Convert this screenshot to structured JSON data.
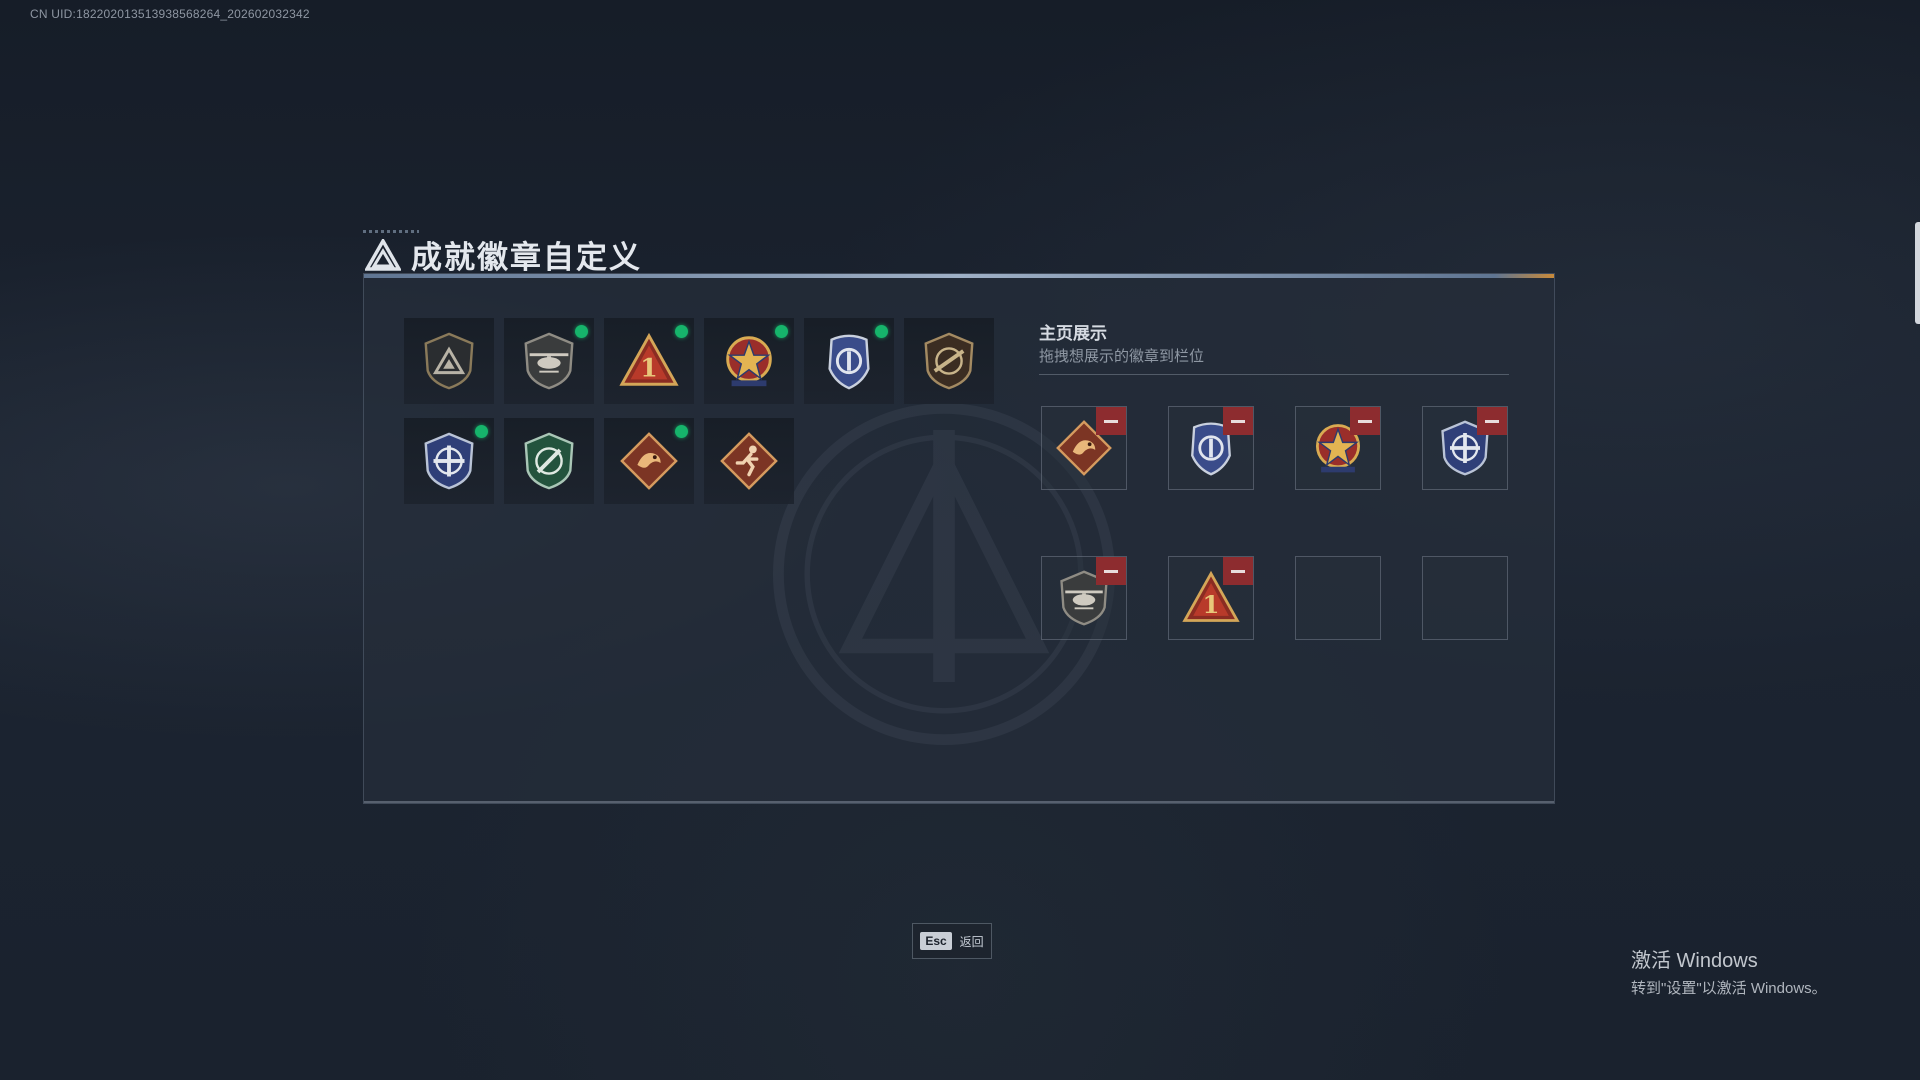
{
  "uid_text": "CN UID:182202013513938568264_202602032342",
  "title": "成就徽章自定义",
  "showcase": {
    "title": "主页展示",
    "subtitle": "拖拽想展示的徽章到栏位"
  },
  "badges": [
    {
      "icon": "triangle-emblem-shield-icon",
      "new": false
    },
    {
      "icon": "helicopter-shield-icon",
      "new": true
    },
    {
      "icon": "number-one-triangle-icon",
      "new": true
    },
    {
      "icon": "star-medal-icon",
      "new": true
    },
    {
      "icon": "police-crest-icon",
      "new": true
    },
    {
      "icon": "rifle-shield-icon",
      "new": false
    },
    {
      "icon": "crosshair-blue-shield-icon",
      "new": true
    },
    {
      "icon": "crosshair-green-shield-icon",
      "new": false
    },
    {
      "icon": "dragon-diamond-icon",
      "new": true
    },
    {
      "icon": "runner-diamond-icon",
      "new": false
    }
  ],
  "slots": [
    {
      "icon": "dragon-diamond-icon",
      "filled": true
    },
    {
      "icon": "police-crest-icon",
      "filled": true
    },
    {
      "icon": "star-medal-icon",
      "filled": true
    },
    {
      "icon": "crosshair-blue-shield-icon",
      "filled": true
    },
    {
      "icon": "helicopter-shield-icon",
      "filled": true
    },
    {
      "icon": "number-one-triangle-icon",
      "filled": true
    },
    {
      "icon": "",
      "filled": false
    },
    {
      "icon": "",
      "filled": false
    }
  ],
  "esc": {
    "key": "Esc",
    "label": "返回"
  },
  "windows_activation": {
    "line1": "激活 Windows",
    "line2": "转到\"设置\"以激活 Windows。"
  },
  "colors": {
    "new_dot": "#16b46b",
    "remove_button": "#8d2c2f",
    "accent_gold": "#c98a3a"
  }
}
